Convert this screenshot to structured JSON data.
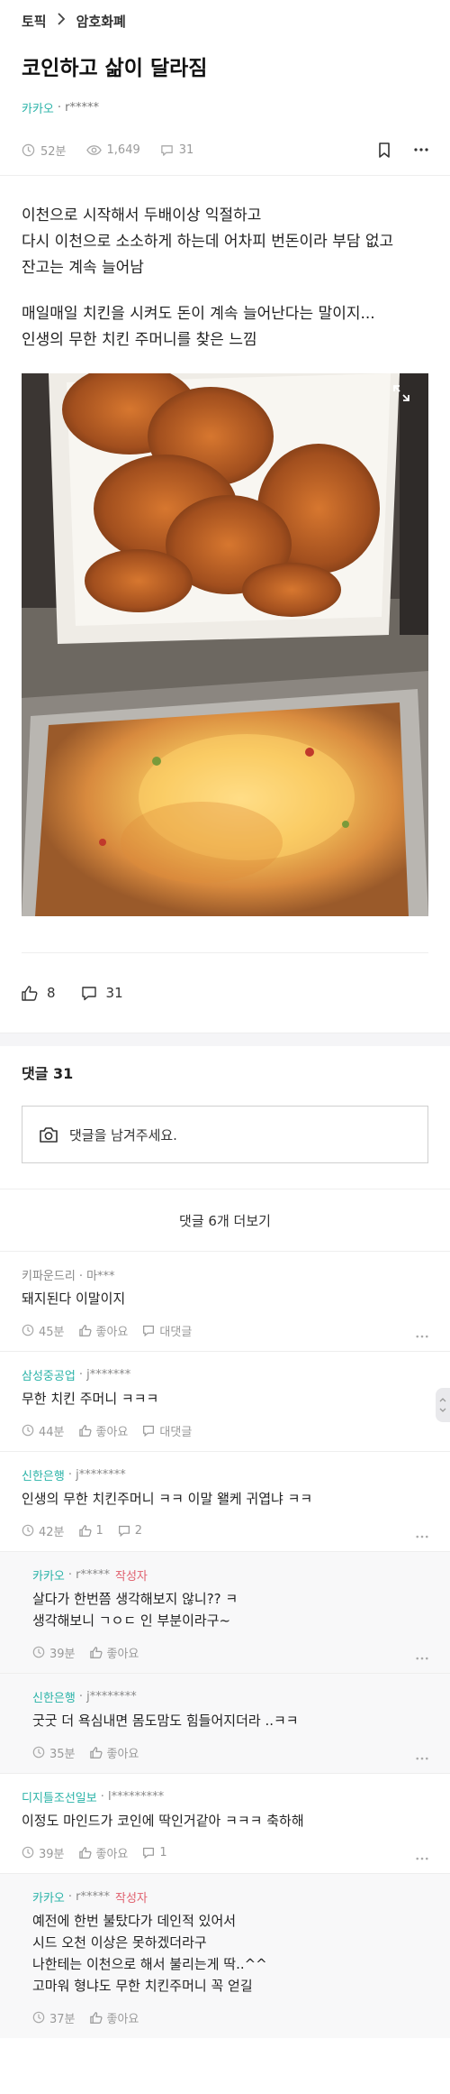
{
  "breadcrumb": {
    "home": "토픽",
    "current": "암호화폐"
  },
  "post": {
    "title": "코인하고 삶이 달라짐",
    "author_company": "카카오",
    "author_nick": "r*****",
    "time": "52분",
    "views": "1,649",
    "comments": "31",
    "body": [
      "이천으로 시작해서 두배이상 익절하고\n다시 이천으로 소소하게 하는데 어차피 번돈이라 부담 없고\n잔고는 계속 늘어남",
      "매일매일 치킨을 시켜도 돈이 계속 늘어난다는 말이지...\n인생의 무한 치킨 주머니를 찾은 느낌"
    ],
    "likes": "8",
    "reply_count": "31"
  },
  "comments_section": {
    "header": "댓글 31",
    "input_placeholder": "댓글을 남겨주세요.",
    "more_label": "댓글 6개 더보기",
    "like_label": "좋아요",
    "reply_label": "대댓글",
    "writer_badge": "작성자"
  },
  "comments": [
    {
      "company": "키파운드리",
      "nick": "마***",
      "text": "돼지된다 이말이지",
      "time": "45분",
      "like": "좋아요",
      "reply": "대댓글"
    },
    {
      "company": "삼성중공업",
      "nick": "j*******",
      "text": "무한 치킨 주머니 ㅋㅋㅋ",
      "time": "44분",
      "like": "좋아요",
      "reply": "대댓글"
    },
    {
      "company": "신한은행",
      "nick": "j********",
      "text": "인생의 무한 치킨주머니 ㅋㅋ 이말 왤케 귀엽냐 ㅋㅋ",
      "time": "42분",
      "like": "1",
      "reply": "2"
    },
    {
      "company": "카카오",
      "nick": "r*****",
      "badge": "작성자",
      "text": "살다가 한번쯤 생각해보지 않니?? ㅋ\n생각해보니 ㄱㅇㄷ 인 부분이라구~",
      "time": "39분",
      "like": "좋아요"
    },
    {
      "company": "신한은행",
      "nick": "j********",
      "text": "굿굿 더 욕심내면 몸도맘도 힘들어지더라 ..ㅋㅋ",
      "time": "35분",
      "like": "좋아요"
    },
    {
      "company": "디지틀조선일보",
      "nick": "l*********",
      "text": "이정도 마인드가 코인에 딱인거같아 ㅋㅋㅋ 축하해",
      "time": "39분",
      "like": "좋아요",
      "reply": "1"
    },
    {
      "company": "카카오",
      "nick": "r*****",
      "badge": "작성자",
      "text": "예전에 한번 불탔다가 데인적 있어서\n시드 오천 이상은 못하겠더라구\n나한테는 이천으로 해서 불리는게 딱..^^\n고마워 형냐도 무한 치킨주머니 꼭 얻길",
      "time": "37분",
      "like": "좋아요"
    }
  ]
}
